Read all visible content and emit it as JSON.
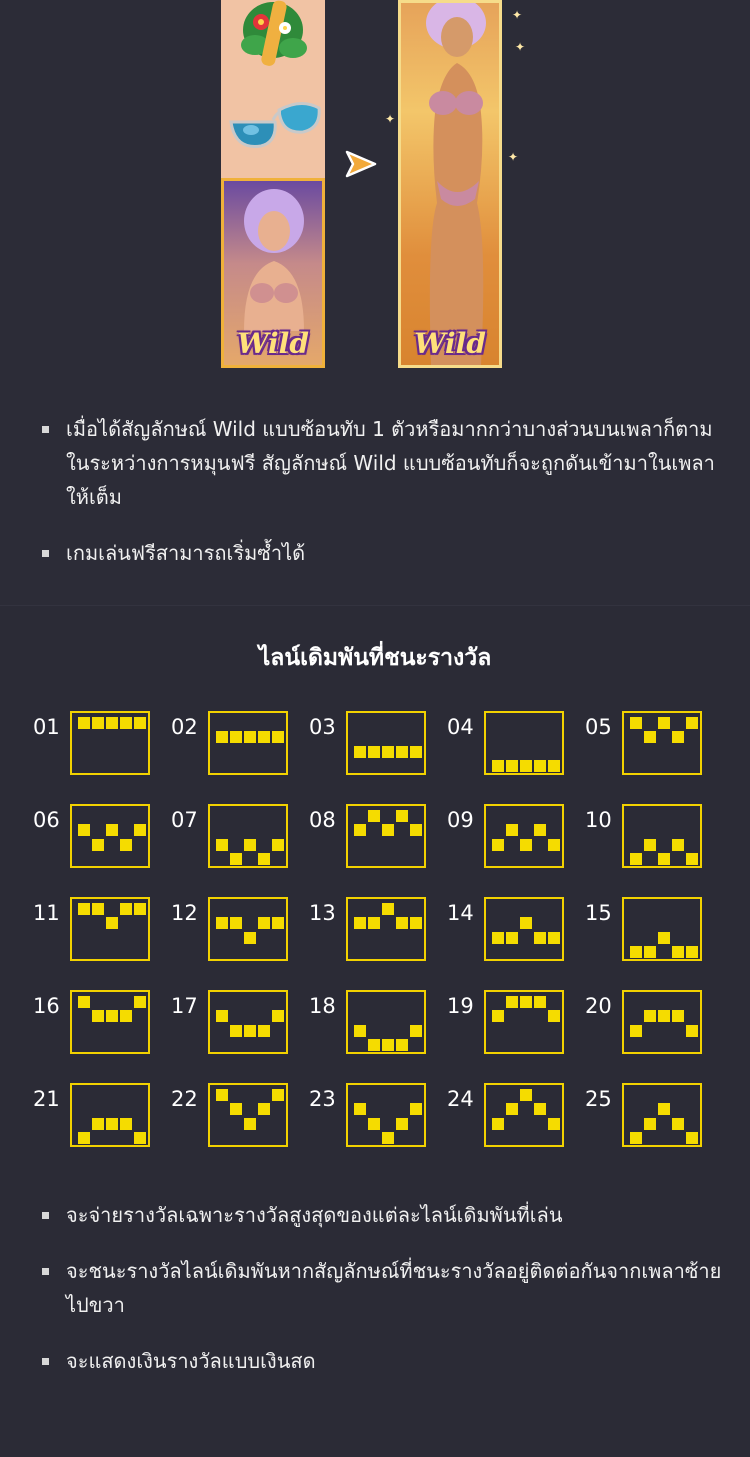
{
  "illustration": {
    "wild_label_small": "Wild",
    "wild_label_big": "Wild"
  },
  "bullets_top": [
    "เมื่อได้สัญลักษณ์ Wild แบบซ้อนทับ 1 ตัวหรือมากกว่าบางส่วนบนเพลาก็ตามในระหว่างการหมุนฟรี สัญลักษณ์ Wild แบบซ้อนทับก็จะถูกดันเข้ามาในเพลาให้เต็ม",
    "เกมเล่นฟรีสามารถเริ่มซ้ำได้"
  ],
  "paylines_title": "ไลน์เดิมพันที่ชนะรางวัล",
  "paylines": [
    {
      "label": "01",
      "rows": [
        0,
        0,
        0,
        0,
        0
      ]
    },
    {
      "label": "02",
      "rows": [
        1,
        1,
        1,
        1,
        1
      ]
    },
    {
      "label": "03",
      "rows": [
        2,
        2,
        2,
        2,
        2
      ]
    },
    {
      "label": "04",
      "rows": [
        3,
        3,
        3,
        3,
        3
      ]
    },
    {
      "label": "05",
      "rows": [
        0,
        1,
        0,
        1,
        0
      ]
    },
    {
      "label": "06",
      "rows": [
        1,
        2,
        1,
        2,
        1
      ]
    },
    {
      "label": "07",
      "rows": [
        2,
        3,
        2,
        3,
        2
      ]
    },
    {
      "label": "08",
      "rows": [
        1,
        0,
        1,
        0,
        1
      ]
    },
    {
      "label": "09",
      "rows": [
        2,
        1,
        2,
        1,
        2
      ]
    },
    {
      "label": "10",
      "rows": [
        3,
        2,
        3,
        2,
        3
      ]
    },
    {
      "label": "11",
      "rows": [
        0,
        0,
        1,
        0,
        0
      ]
    },
    {
      "label": "12",
      "rows": [
        1,
        1,
        2,
        1,
        1
      ]
    },
    {
      "label": "13",
      "rows": [
        1,
        1,
        0,
        1,
        1
      ]
    },
    {
      "label": "14",
      "rows": [
        2,
        2,
        1,
        2,
        2
      ]
    },
    {
      "label": "15",
      "rows": [
        3,
        3,
        2,
        3,
        3
      ]
    },
    {
      "label": "16",
      "rows": [
        0,
        1,
        1,
        1,
        0
      ]
    },
    {
      "label": "17",
      "rows": [
        1,
        2,
        2,
        2,
        1
      ]
    },
    {
      "label": "18",
      "rows": [
        2,
        3,
        3,
        3,
        2
      ]
    },
    {
      "label": "19",
      "rows": [
        1,
        0,
        0,
        0,
        1
      ]
    },
    {
      "label": "20",
      "rows": [
        2,
        1,
        1,
        1,
        2
      ]
    },
    {
      "label": "21",
      "rows": [
        3,
        2,
        2,
        2,
        3
      ]
    },
    {
      "label": "22",
      "rows": [
        0,
        1,
        2,
        1,
        0
      ]
    },
    {
      "label": "23",
      "rows": [
        1,
        2,
        3,
        2,
        1
      ]
    },
    {
      "label": "24",
      "rows": [
        2,
        1,
        0,
        1,
        2
      ]
    },
    {
      "label": "25",
      "rows": [
        3,
        2,
        1,
        2,
        3
      ]
    }
  ],
  "bullets_bottom": [
    "จะจ่ายรางวัลเฉพาะรางวัลสูงสุดของแต่ละไลน์เดิมพันที่เล่น",
    "จะชนะรางวัลไลน์เดิมพันหากสัญลักษณ์ที่ชนะรางวัลอยู่ติดต่อกันจากเพลาซ้ายไปขวา",
    "จะแสดงเงินรางวัลแบบเงินสด"
  ],
  "colors": {
    "background": "#2d2d38",
    "payline_frame": "#f2d200",
    "payline_cell": "#f5dc00"
  }
}
